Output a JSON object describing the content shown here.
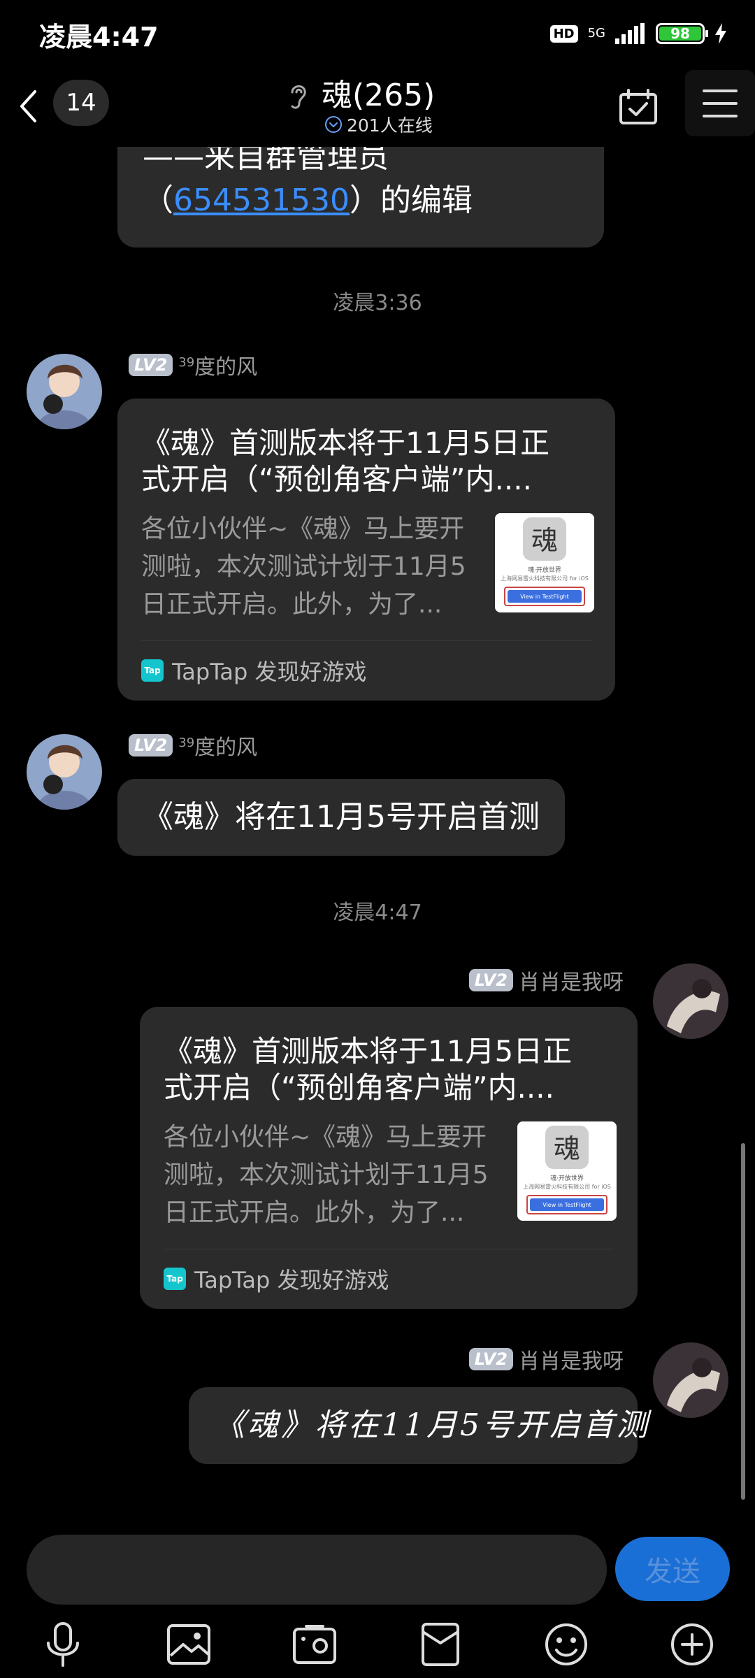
{
  "status_bar": {
    "time": "凌晨4:47",
    "hd": "HD",
    "network": "5G",
    "battery": "98"
  },
  "header": {
    "unread_count": "14",
    "title": "魂(265)",
    "online_text": "201人在线"
  },
  "messages": {
    "partial": {
      "line1": "——来自群管理员",
      "open_paren": "（",
      "admin_id": "654531530",
      "close_text": "）的编辑"
    },
    "ts1": "凌晨3:36",
    "m1": {
      "level": "LV2",
      "level_num": "39",
      "sender": "度的风",
      "card_title": "《魂》首测版本将于11月5日正式开启（“预创角客户端”内....",
      "card_desc": "各位小伙伴~《魂》马上要开测啦，本次测试计划于11月5日正式开启。此外，为了...",
      "card_source": "TapTap 发现好游戏",
      "thumb_text1": "魂·开放世界",
      "thumb_text2": "上海网易雷火科技有限公司 for iOS",
      "thumb_button": "View in TestFlight"
    },
    "m2": {
      "level": "LV2",
      "level_num": "39",
      "sender": "度的风",
      "text": "《魂》将在11月5号开启首测"
    },
    "ts2": "凌晨4:47",
    "m3": {
      "level": "LV2",
      "sender": "肖肖是我呀",
      "card_title": "《魂》首测版本将于11月5日正式开启（“预创角客户端”内....",
      "card_desc": "各位小伙伴~《魂》马上要开测啦，本次测试计划于11月5日正式开启。此外，为了...",
      "card_source": "TapTap 发现好游戏",
      "thumb_text1": "魂·开放世界",
      "thumb_text2": "上海网易雷火科技有限公司 for iOS",
      "thumb_button": "View in TestFlight"
    },
    "m4": {
      "level": "LV2",
      "sender": "肖肖是我呀",
      "text": "《魂》将在11月5号开启首测"
    }
  },
  "input": {
    "send_label": "发送"
  },
  "tap_logo": "Tap",
  "colors": {
    "background": "#000000",
    "bubble": "#2b2b2b",
    "accent": "#1a6fd6",
    "link": "#3a8eff",
    "battery": "#2fc63a"
  }
}
